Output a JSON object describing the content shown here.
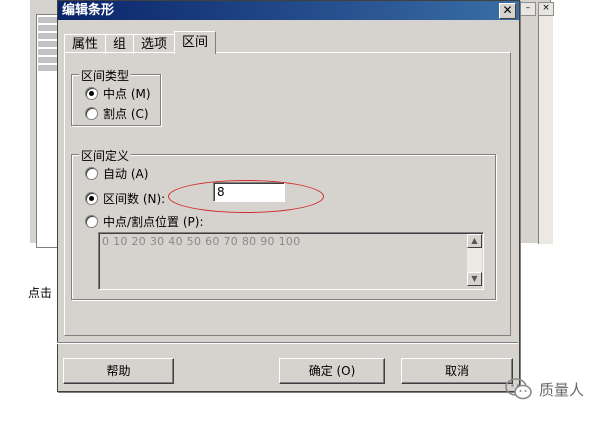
{
  "background": {
    "side_text": "点击"
  },
  "dialog": {
    "title": "编辑条形",
    "close_label": "✕",
    "tabs": [
      {
        "label": "属性",
        "active": false
      },
      {
        "label": "组",
        "active": false
      },
      {
        "label": "选项",
        "active": false
      },
      {
        "label": "区间",
        "active": true
      }
    ],
    "interval_type": {
      "legend": "区间类型",
      "options": [
        {
          "label": "中点 (M)",
          "checked": true
        },
        {
          "label": "割点 (C)",
          "checked": false
        }
      ]
    },
    "interval_definition": {
      "legend": "区间定义",
      "auto_label": "自动 (A)",
      "count_label": "区间数 (N):",
      "count_value": "8",
      "position_label": "中点/割点位置 (P):",
      "position_value": "0 10 20 30 40 50 60 70 80 90 100"
    },
    "buttons": {
      "help": "帮助",
      "ok": "确定 (O)",
      "cancel": "取消"
    }
  },
  "watermark": {
    "text": "质量人"
  },
  "colors": {
    "title_bar": "#0a246a",
    "highlight": "#d02a2a",
    "dialog_bg": "#d6d3ce"
  }
}
